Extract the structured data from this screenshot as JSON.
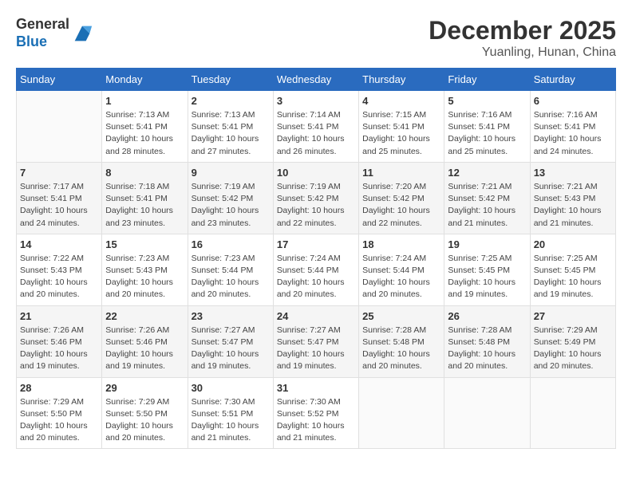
{
  "header": {
    "logo_line1": "General",
    "logo_line2": "Blue",
    "month": "December 2025",
    "location": "Yuanling, Hunan, China"
  },
  "days_of_week": [
    "Sunday",
    "Monday",
    "Tuesday",
    "Wednesday",
    "Thursday",
    "Friday",
    "Saturday"
  ],
  "weeks": [
    [
      {
        "day": "",
        "info": ""
      },
      {
        "day": "1",
        "info": "Sunrise: 7:13 AM\nSunset: 5:41 PM\nDaylight: 10 hours\nand 28 minutes."
      },
      {
        "day": "2",
        "info": "Sunrise: 7:13 AM\nSunset: 5:41 PM\nDaylight: 10 hours\nand 27 minutes."
      },
      {
        "day": "3",
        "info": "Sunrise: 7:14 AM\nSunset: 5:41 PM\nDaylight: 10 hours\nand 26 minutes."
      },
      {
        "day": "4",
        "info": "Sunrise: 7:15 AM\nSunset: 5:41 PM\nDaylight: 10 hours\nand 25 minutes."
      },
      {
        "day": "5",
        "info": "Sunrise: 7:16 AM\nSunset: 5:41 PM\nDaylight: 10 hours\nand 25 minutes."
      },
      {
        "day": "6",
        "info": "Sunrise: 7:16 AM\nSunset: 5:41 PM\nDaylight: 10 hours\nand 24 minutes."
      }
    ],
    [
      {
        "day": "7",
        "info": "Sunrise: 7:17 AM\nSunset: 5:41 PM\nDaylight: 10 hours\nand 24 minutes."
      },
      {
        "day": "8",
        "info": "Sunrise: 7:18 AM\nSunset: 5:41 PM\nDaylight: 10 hours\nand 23 minutes."
      },
      {
        "day": "9",
        "info": "Sunrise: 7:19 AM\nSunset: 5:42 PM\nDaylight: 10 hours\nand 23 minutes."
      },
      {
        "day": "10",
        "info": "Sunrise: 7:19 AM\nSunset: 5:42 PM\nDaylight: 10 hours\nand 22 minutes."
      },
      {
        "day": "11",
        "info": "Sunrise: 7:20 AM\nSunset: 5:42 PM\nDaylight: 10 hours\nand 22 minutes."
      },
      {
        "day": "12",
        "info": "Sunrise: 7:21 AM\nSunset: 5:42 PM\nDaylight: 10 hours\nand 21 minutes."
      },
      {
        "day": "13",
        "info": "Sunrise: 7:21 AM\nSunset: 5:43 PM\nDaylight: 10 hours\nand 21 minutes."
      }
    ],
    [
      {
        "day": "14",
        "info": "Sunrise: 7:22 AM\nSunset: 5:43 PM\nDaylight: 10 hours\nand 20 minutes."
      },
      {
        "day": "15",
        "info": "Sunrise: 7:23 AM\nSunset: 5:43 PM\nDaylight: 10 hours\nand 20 minutes."
      },
      {
        "day": "16",
        "info": "Sunrise: 7:23 AM\nSunset: 5:44 PM\nDaylight: 10 hours\nand 20 minutes."
      },
      {
        "day": "17",
        "info": "Sunrise: 7:24 AM\nSunset: 5:44 PM\nDaylight: 10 hours\nand 20 minutes."
      },
      {
        "day": "18",
        "info": "Sunrise: 7:24 AM\nSunset: 5:44 PM\nDaylight: 10 hours\nand 20 minutes."
      },
      {
        "day": "19",
        "info": "Sunrise: 7:25 AM\nSunset: 5:45 PM\nDaylight: 10 hours\nand 19 minutes."
      },
      {
        "day": "20",
        "info": "Sunrise: 7:25 AM\nSunset: 5:45 PM\nDaylight: 10 hours\nand 19 minutes."
      }
    ],
    [
      {
        "day": "21",
        "info": "Sunrise: 7:26 AM\nSunset: 5:46 PM\nDaylight: 10 hours\nand 19 minutes."
      },
      {
        "day": "22",
        "info": "Sunrise: 7:26 AM\nSunset: 5:46 PM\nDaylight: 10 hours\nand 19 minutes."
      },
      {
        "day": "23",
        "info": "Sunrise: 7:27 AM\nSunset: 5:47 PM\nDaylight: 10 hours\nand 19 minutes."
      },
      {
        "day": "24",
        "info": "Sunrise: 7:27 AM\nSunset: 5:47 PM\nDaylight: 10 hours\nand 19 minutes."
      },
      {
        "day": "25",
        "info": "Sunrise: 7:28 AM\nSunset: 5:48 PM\nDaylight: 10 hours\nand 20 minutes."
      },
      {
        "day": "26",
        "info": "Sunrise: 7:28 AM\nSunset: 5:48 PM\nDaylight: 10 hours\nand 20 minutes."
      },
      {
        "day": "27",
        "info": "Sunrise: 7:29 AM\nSunset: 5:49 PM\nDaylight: 10 hours\nand 20 minutes."
      }
    ],
    [
      {
        "day": "28",
        "info": "Sunrise: 7:29 AM\nSunset: 5:50 PM\nDaylight: 10 hours\nand 20 minutes."
      },
      {
        "day": "29",
        "info": "Sunrise: 7:29 AM\nSunset: 5:50 PM\nDaylight: 10 hours\nand 20 minutes."
      },
      {
        "day": "30",
        "info": "Sunrise: 7:30 AM\nSunset: 5:51 PM\nDaylight: 10 hours\nand 21 minutes."
      },
      {
        "day": "31",
        "info": "Sunrise: 7:30 AM\nSunset: 5:52 PM\nDaylight: 10 hours\nand 21 minutes."
      },
      {
        "day": "",
        "info": ""
      },
      {
        "day": "",
        "info": ""
      },
      {
        "day": "",
        "info": ""
      }
    ]
  ]
}
